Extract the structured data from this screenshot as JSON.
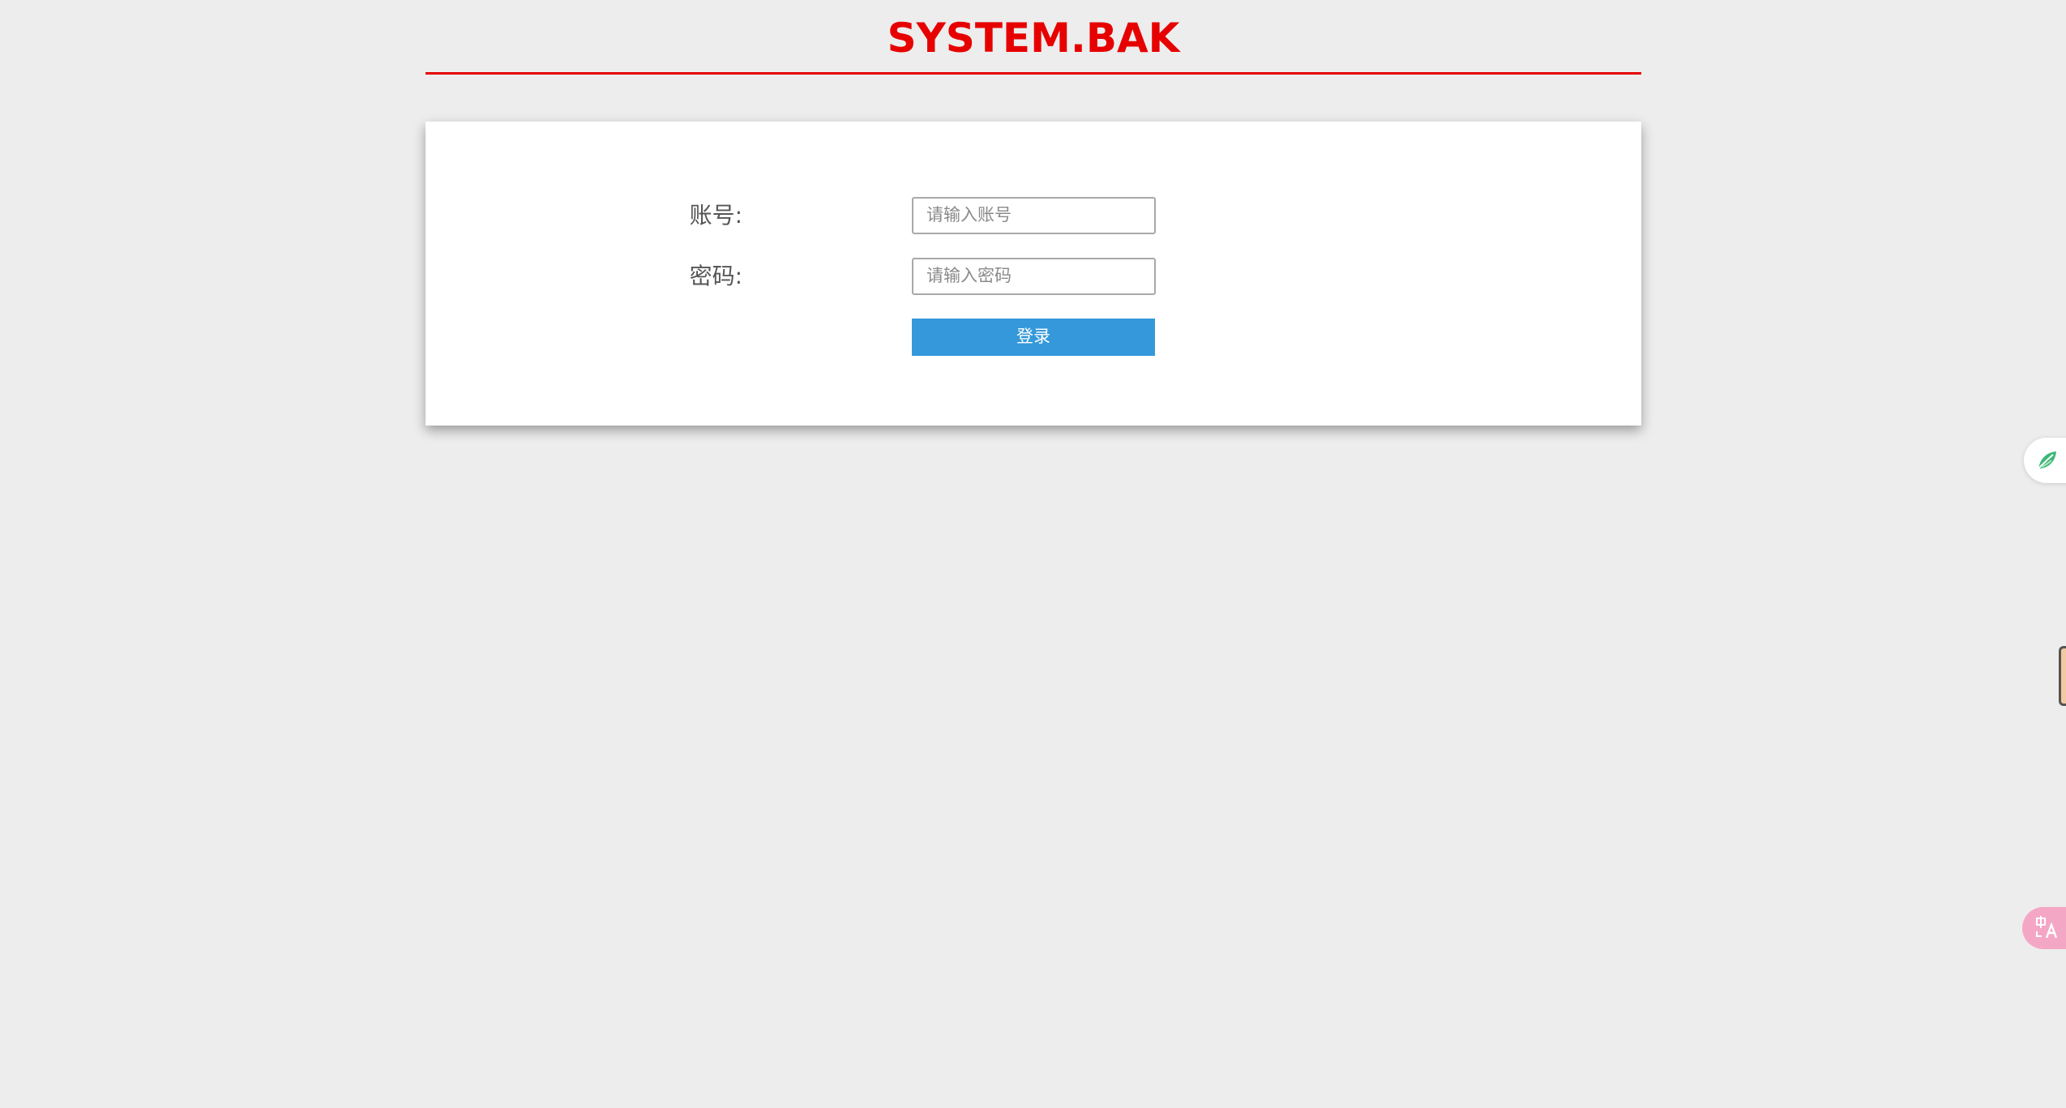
{
  "header": {
    "title": "SYSTEM.BAK"
  },
  "login_form": {
    "account": {
      "label": "账号:",
      "placeholder": "请输入账号",
      "value": ""
    },
    "password": {
      "label": "密码:",
      "placeholder": "请输入密码",
      "value": ""
    },
    "submit_label": "登录"
  },
  "floating_widgets": {
    "leaf_icon": "leaf-icon",
    "translate_icon": "translate-icon"
  },
  "colors": {
    "brand_red": "#e60000",
    "button_blue": "#3498db",
    "page_bg": "#ededed"
  }
}
